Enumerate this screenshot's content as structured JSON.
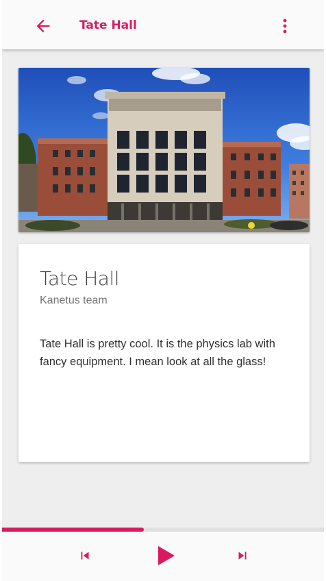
{
  "app_bar": {
    "title": "Tate Hall",
    "back_icon": "arrow-back-icon",
    "menu_icon": "more-vert-icon",
    "accent_color": "#d81b60"
  },
  "hero_image": {
    "subject": "photo of Tate Hall building"
  },
  "card": {
    "title": "Tate Hall",
    "subtitle": "Kanetus team",
    "body": "Tate Hall is pretty cool. It is the physics lab with fancy equipment. I mean look at all the glass!"
  },
  "player": {
    "progress": 0.44,
    "prev_icon": "skip-previous-icon",
    "play_icon": "play-icon",
    "next_icon": "skip-next-icon"
  }
}
